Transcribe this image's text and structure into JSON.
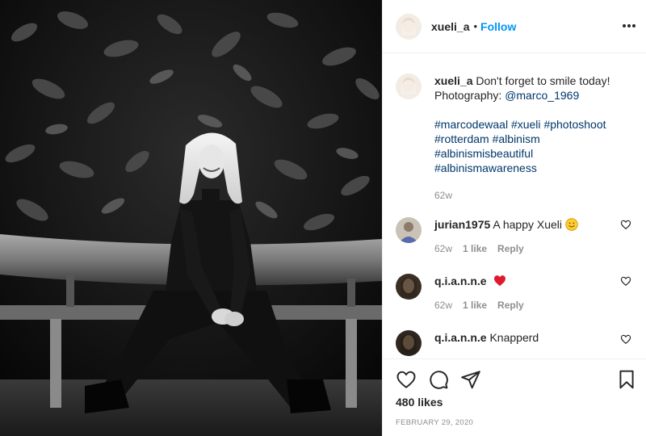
{
  "post": {
    "username": "xueli_a",
    "separator": "•",
    "follow_label": "Follow",
    "more_icon": "more-options-icon"
  },
  "caption": {
    "username": "xueli_a",
    "text": "Don't forget to smile today!",
    "credit_prefix": "Photography:",
    "credit_handle": "@marco_1969",
    "hashtags": [
      "#marcodewaal",
      "#xueli",
      "#photoshoot",
      "#rotterdam",
      "#albinism",
      "#albinismisbeautiful",
      "#albinismawareness"
    ],
    "age": "62w"
  },
  "comments": [
    {
      "username": "jurian1975",
      "text": "A happy Xueli",
      "emoji": "smiling-face-emoji",
      "age": "62w",
      "likes": "1 like",
      "reply_label": "Reply"
    },
    {
      "username": "q.i.a.n.n.e",
      "text": "",
      "emoji": "red-heart-emoji",
      "age": "62w",
      "likes": "1 like",
      "reply_label": "Reply"
    },
    {
      "username": "q.i.a.n.n.e",
      "text": "Knapperd",
      "emoji": "",
      "age": "",
      "likes": "",
      "reply_label": ""
    }
  ],
  "footer": {
    "like_icon": "heart-outline-icon",
    "comment_icon": "comment-icon",
    "share_icon": "paper-plane-icon",
    "save_icon": "bookmark-icon",
    "likes_count": "480 likes",
    "date": "FEBRUARY 29, 2020"
  },
  "colors": {
    "link": "#00376b",
    "follow": "#0095f6",
    "meta": "#8e8e8e",
    "text": "#262626",
    "border": "#efefef"
  }
}
